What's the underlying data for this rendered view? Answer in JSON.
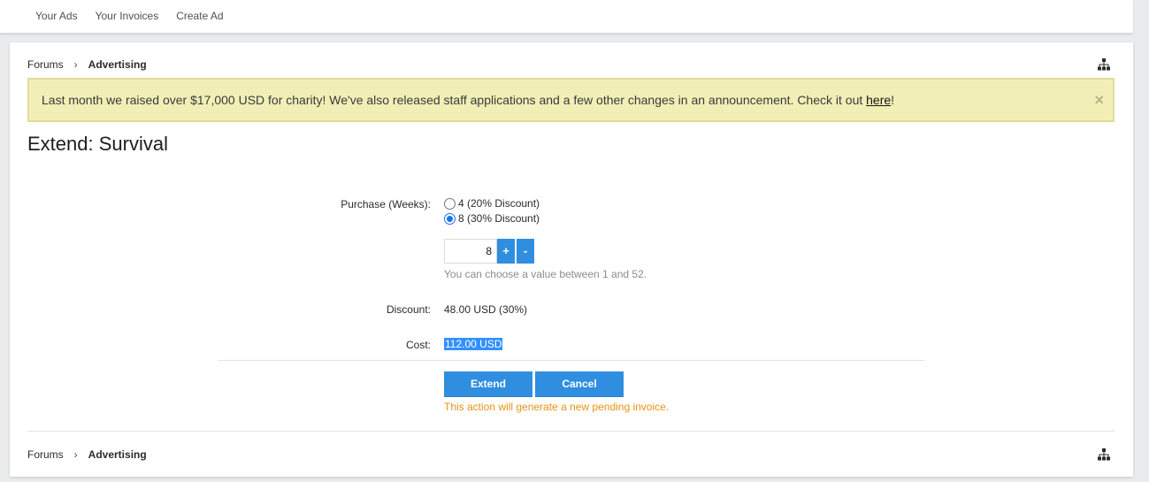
{
  "top_tabs": [
    "Your Ads",
    "Your Invoices",
    "Create Ad"
  ],
  "breadcrumb": {
    "root": "Forums",
    "separator": "›",
    "current": "Advertising"
  },
  "notice": {
    "text": "Last month we raised over $17,000 USD for charity! We've also released staff applications and a few other changes in an announcement. Check it out ",
    "link_text": "here",
    "suffix": "!",
    "close_label": "×"
  },
  "page_title": "Extend: Survival",
  "form": {
    "purchase_label": "Purchase (Weeks):",
    "options": [
      {
        "label": "4 (20% Discount)",
        "checked": false
      },
      {
        "label": "8 (30% Discount)",
        "checked": true
      }
    ],
    "weeks_value": "8",
    "plus_label": "+",
    "minus_label": "-",
    "hint": "You can choose a value between 1 and 52.",
    "discount_label": "Discount:",
    "discount_value": "48.00 USD (30%)",
    "cost_label": "Cost:",
    "cost_value": "112.00 USD"
  },
  "buttons": {
    "extend": "Extend",
    "cancel": "Cancel"
  },
  "warning": "This action will generate a new pending invoice.",
  "colors": {
    "accent": "#2f8ee0",
    "notice_bg": "#f2efb6",
    "warning": "#e79316"
  }
}
